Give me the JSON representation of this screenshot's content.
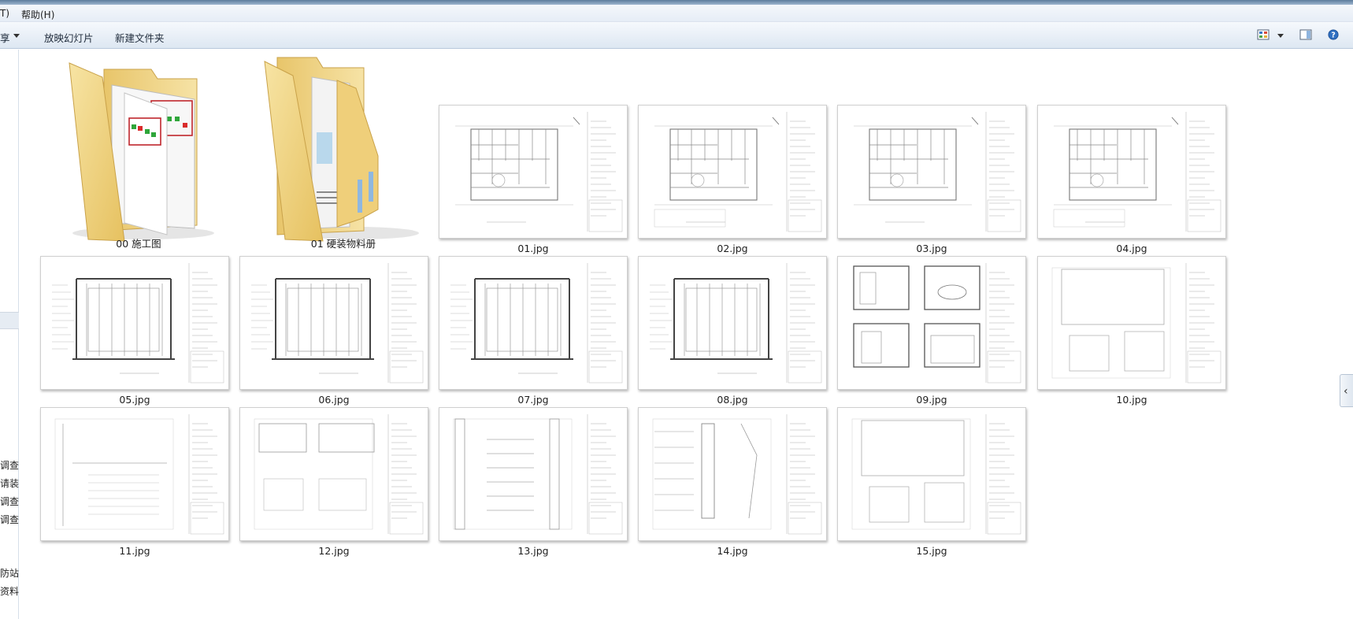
{
  "menu": {
    "tools_fragment": "T)",
    "help": "帮助(H)"
  },
  "toolbar": {
    "share_fragment": "享",
    "slideshow": "放映幻灯片",
    "new_folder": "新建文件夹"
  },
  "left_pane": {
    "items": [
      "调查",
      "请装",
      "调查",
      "调查",
      "防站",
      "资料"
    ]
  },
  "folders": [
    {
      "name": "00 施工图"
    },
    {
      "name": "01 硬装物料册"
    }
  ],
  "files": [
    {
      "name": "01.jpg",
      "kind": "plan"
    },
    {
      "name": "02.jpg",
      "kind": "plan"
    },
    {
      "name": "03.jpg",
      "kind": "plan"
    },
    {
      "name": "04.jpg",
      "kind": "plan"
    },
    {
      "name": "05.jpg",
      "kind": "elev"
    },
    {
      "name": "06.jpg",
      "kind": "elev"
    },
    {
      "name": "07.jpg",
      "kind": "elev"
    },
    {
      "name": "08.jpg",
      "kind": "elev"
    },
    {
      "name": "09.jpg",
      "kind": "quad"
    },
    {
      "name": "10.jpg",
      "kind": "detail"
    },
    {
      "name": "11.jpg",
      "kind": "detail"
    },
    {
      "name": "12.jpg",
      "kind": "detail"
    },
    {
      "name": "13.jpg",
      "kind": "detail"
    },
    {
      "name": "14.jpg",
      "kind": "detail"
    },
    {
      "name": "15.jpg",
      "kind": "detail"
    }
  ],
  "colors": {
    "folder": "#f2d98c",
    "toolbar_bg": "#e3ebf5",
    "selection": "#e6ecf3"
  }
}
